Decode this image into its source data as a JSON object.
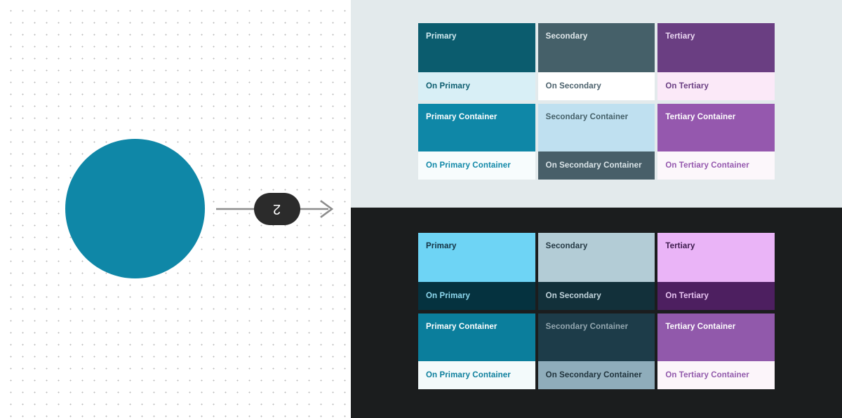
{
  "canvas": {
    "shape": {
      "name": "teal-circle",
      "fill": "#0f87a7"
    },
    "step_badge": {
      "label": "2",
      "background": "#2b2b2b",
      "text_color": "#ffffff"
    },
    "arrow": {
      "color": "#8c8c8c",
      "direction": "right"
    },
    "grid": {
      "dot_color": "#b9b9b9",
      "spacing_px": 17,
      "background": "#ffffff"
    }
  },
  "schemes": [
    {
      "id": "light",
      "panel_background": "#e3eaec",
      "columns": [
        {
          "id": "primary",
          "tone": {
            "label": "Primary",
            "bg": "#0b5c6e",
            "fg": "#d4ecf2"
          },
          "on_tone": {
            "label": "On Primary",
            "bg": "#d8eff6",
            "fg": "#0b5c6e"
          },
          "container": {
            "label": "Primary Container",
            "bg": "#0f87a7",
            "fg": "#ffffff"
          },
          "on_container": {
            "label": "On Primary Container",
            "bg": "#f7fcfd",
            "fg": "#0f87a7"
          }
        },
        {
          "id": "secondary",
          "tone": {
            "label": "Secondary",
            "bg": "#456069",
            "fg": "#e2e9ec"
          },
          "on_tone": {
            "label": "On Secondary",
            "bg": "#ffffff",
            "fg": "#4b616c"
          },
          "container": {
            "label": "Secondary Container",
            "bg": "#bfe0f0",
            "fg": "#456069"
          },
          "on_container": {
            "label": "On Secondary Container",
            "bg": "#485f69",
            "fg": "#dbe5e9"
          }
        },
        {
          "id": "tertiary",
          "tone": {
            "label": "Tertiary",
            "bg": "#6a3e82",
            "fg": "#ecd9f3"
          },
          "on_tone": {
            "label": "On Tertiary",
            "bg": "#fbe9f8",
            "fg": "#6a3e82"
          },
          "container": {
            "label": "Tertiary Container",
            "bg": "#9558ae",
            "fg": "#ffffff"
          },
          "on_container": {
            "label": "On Tertiary Container",
            "bg": "#fcf7fb",
            "fg": "#9558ae"
          }
        }
      ]
    },
    {
      "id": "dark",
      "panel_background": "#1b1d1e",
      "columns": [
        {
          "id": "primary",
          "tone": {
            "label": "Primary",
            "bg": "#6ed4f5",
            "fg": "#143243"
          },
          "on_tone": {
            "label": "On Primary",
            "bg": "#05323f",
            "fg": "#8fd9ef"
          },
          "container": {
            "label": "Primary Container",
            "bg": "#0b7e9c",
            "fg": "#ffffff"
          },
          "on_container": {
            "label": "On Primary Container",
            "bg": "#f3fafb",
            "fg": "#0b7e9c"
          }
        },
        {
          "id": "secondary",
          "tone": {
            "label": "Secondary",
            "bg": "#b3ccd6",
            "fg": "#253944"
          },
          "on_tone": {
            "label": "On Secondary",
            "bg": "#12303a",
            "fg": "#c3d5dd"
          },
          "container": {
            "label": "Secondary Container",
            "bg": "#1d3c49",
            "fg": "#94a7b0"
          },
          "on_container": {
            "label": "On Secondary Container",
            "bg": "#8fadbb",
            "fg": "#20333c"
          }
        },
        {
          "id": "tertiary",
          "tone": {
            "label": "Tertiary",
            "bg": "#eab4f7",
            "fg": "#3c1a4c"
          },
          "on_tone": {
            "label": "On Tertiary",
            "bg": "#4d1f60",
            "fg": "#e6c3f0"
          },
          "container": {
            "label": "Tertiary Container",
            "bg": "#9159ab",
            "fg": "#ffffff"
          },
          "on_container": {
            "label": "On Tertiary Container",
            "bg": "#fcf5fa",
            "fg": "#9159ab"
          }
        }
      ]
    }
  ]
}
